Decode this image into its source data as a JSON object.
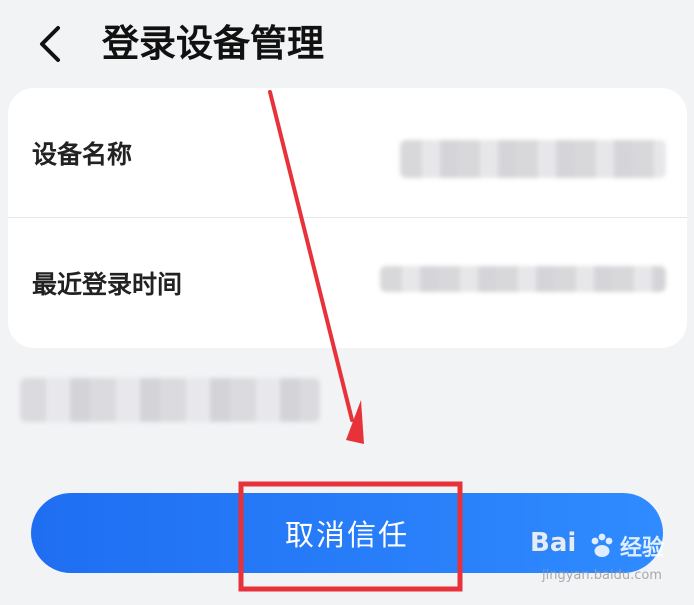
{
  "header": {
    "back_icon": "chevron-left-icon",
    "title": "登录设备管理"
  },
  "device_info": {
    "rows": [
      {
        "label": "设备名称"
      },
      {
        "label": "最近登录时间"
      }
    ]
  },
  "action": {
    "label": "取消信任",
    "color_start": "#1f6ef2",
    "color_end": "#2f8bff"
  },
  "annotation": {
    "color": "#e8323a"
  },
  "watermark": {
    "brand": "Bai",
    "suffix": "经验",
    "url": "jingyan.baidu.com"
  }
}
